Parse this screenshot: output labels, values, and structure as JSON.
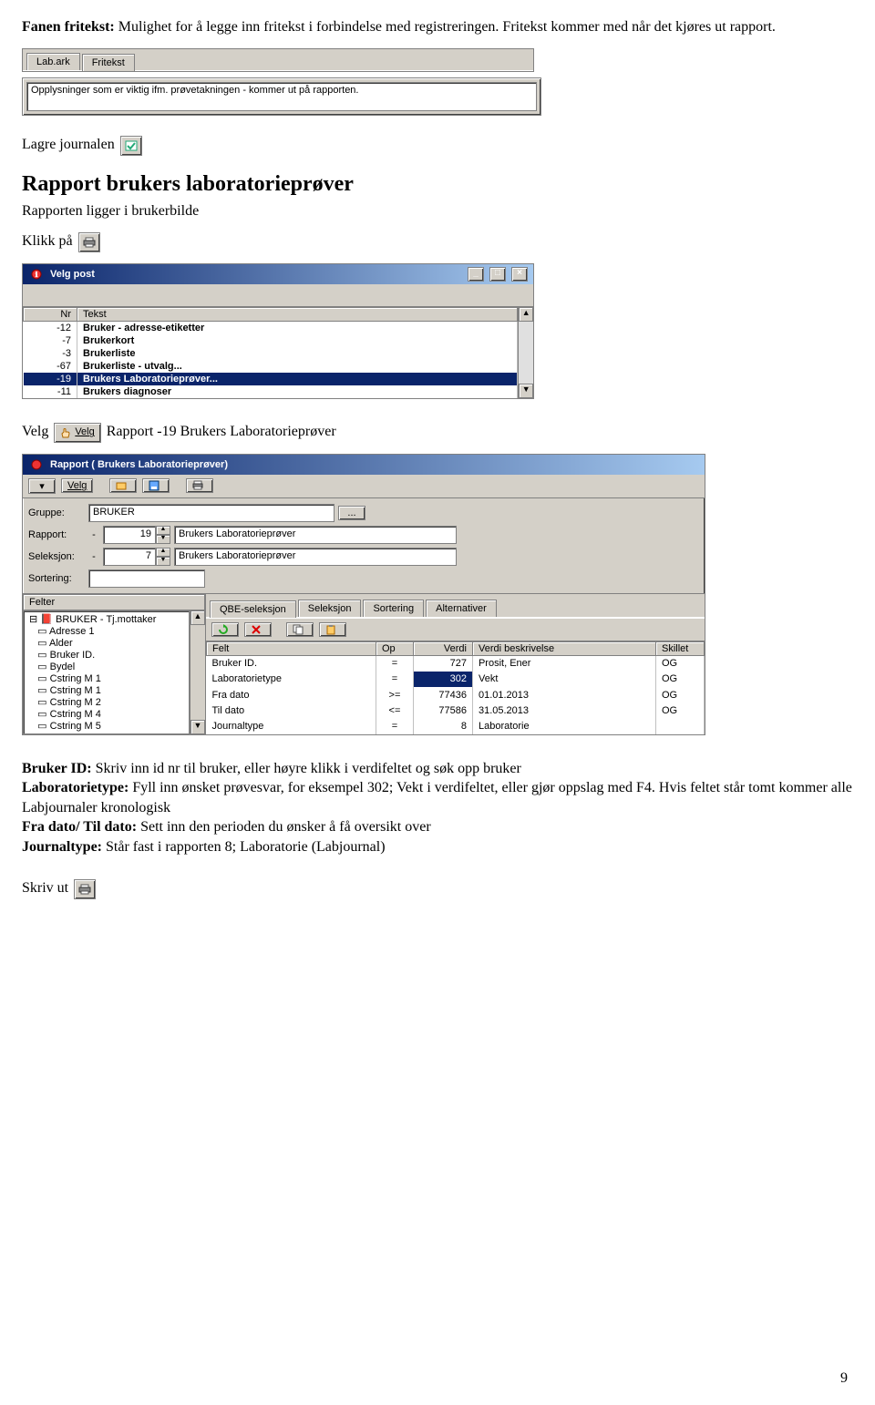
{
  "intro": {
    "prefix_bold": "Fanen fritekst:",
    "text": " Mulighet for å legge inn fritekst i forbindelse med registreringen. Fritekst kommer med når det kjøres ut rapport."
  },
  "tabs1": {
    "tab0": "Lab.ark",
    "tab1": "Fritekst"
  },
  "freetext_field": "Opplysninger som er viktig ifm. prøvetakningen - kommer ut på rapporten.",
  "lagre_journalen": "Lagre journalen",
  "heading1": "Rapport brukers laboratorieprøver",
  "sub1": "Rapporten ligger i brukerbilde",
  "klikk_pa": "Klikk på",
  "velgpost": {
    "title": "Velg post",
    "nr_header": "Nr",
    "tekst_header": "Tekst",
    "rows": [
      {
        "nr": "-12",
        "tekst": "Bruker - adresse-etiketter"
      },
      {
        "nr": "-7",
        "tekst": "Brukerkort"
      },
      {
        "nr": "-3",
        "tekst": "Brukerliste"
      },
      {
        "nr": "-67",
        "tekst": "Brukerliste - utvalg..."
      },
      {
        "nr": "-19",
        "tekst": "Brukers Laboratorieprøver..."
      },
      {
        "nr": "-11",
        "tekst": "Brukers diagnoser"
      }
    ],
    "selected_index": 4
  },
  "velg_line": {
    "prefix": "Velg",
    "btn": "Velg",
    "rest": " Rapport -19 Brukers Laboratorieprøver"
  },
  "rapport_window": {
    "title": "Rapport ( Brukers Laboratorieprøver)",
    "toolbar_velg": "Velg",
    "gruppe_label": "Gruppe:",
    "gruppe_value": "BRUKER",
    "rapport_label": "Rapport:",
    "rapport_num": "19",
    "rapport_prefix": "-",
    "rapport_desc": "Brukers Laboratorieprøver",
    "seleksjon_label": "Seleksjon:",
    "seleksjon_num": "7",
    "seleksjon_prefix": "-",
    "seleksjon_desc": "Brukers Laboratorieprøver",
    "sortering_label": "Sortering:",
    "sortering_value": "",
    "felter_header": "Felter",
    "tree_root": "BRUKER - Tj.mottaker",
    "tree_items": [
      "Adresse 1",
      "Alder",
      "Bruker ID.",
      "Bydel",
      "Cstring M 1",
      "Cstring M 1",
      "Cstring M 2",
      "Cstring M 4",
      "Cstring M 5"
    ],
    "tabs": [
      "QBE-seleksjon",
      "Seleksjon",
      "Sortering",
      "Alternativer"
    ],
    "tabs_active": 0,
    "grid_headers": [
      "Felt",
      "Op",
      "Verdi",
      "Verdi beskrivelse",
      "Skillet"
    ],
    "grid_rows": [
      {
        "felt": "Bruker ID.",
        "op": "=",
        "verdi": "727",
        "desc": "Prosit, Ener",
        "sk": "OG"
      },
      {
        "felt": "Laboratorietype",
        "op": "=",
        "verdi": "302",
        "desc": "Vekt",
        "sk": "OG"
      },
      {
        "felt": "Fra dato",
        "op": ">=",
        "verdi": "77436",
        "desc": "01.01.2013",
        "sk": "OG"
      },
      {
        "felt": "Til dato",
        "op": "<=",
        "verdi": "77586",
        "desc": "31.05.2013",
        "sk": "OG"
      },
      {
        "felt": "Journaltype",
        "op": "=",
        "verdi": "8",
        "desc": "Laboratorie",
        "sk": ""
      }
    ],
    "grid_selected_index": 1
  },
  "explain": {
    "l1b": "Bruker ID:",
    "l1": " Skriv inn id nr til bruker, eller høyre klikk i verdifeltet og søk opp bruker",
    "l2b": "Laboratorietype:",
    "l2": " Fyll inn ønsket prøvesvar, for eksempel 302; Vekt i verdifeltet, eller gjør oppslag med F4. Hvis feltet står tomt kommer alle Labjournaler kronologisk",
    "l3b": "Fra dato/ Til dato:",
    "l3": " Sett inn den perioden du ønsker å få oversikt over",
    "l4b": "Journaltype:",
    "l4": " Står fast i rapporten 8; Laboratorie (Labjournal)"
  },
  "skriv_ut": "Skriv ut",
  "page_number": "9"
}
